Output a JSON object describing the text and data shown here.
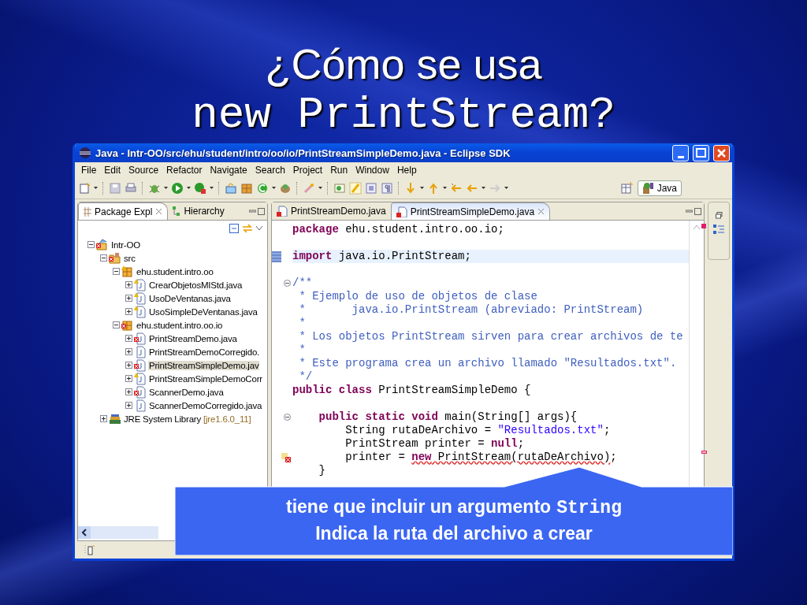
{
  "slide": {
    "title_lines": [
      "¿Cómo se usa",
      "new PrintStream?"
    ]
  },
  "window": {
    "title": "Java - Intr-OO/src/ehu/student/intro/oo/io/PrintStreamSimpleDemo.java - Eclipse SDK"
  },
  "menu": [
    "File",
    "Edit",
    "Source",
    "Refactor",
    "Navigate",
    "Search",
    "Project",
    "Run",
    "Window",
    "Help"
  ],
  "perspective": {
    "label": "Java",
    "selected": true
  },
  "left_tabs": [
    {
      "label": "Package Expl",
      "selected": true
    },
    {
      "label": "Hierarchy",
      "selected": false
    }
  ],
  "tree": [
    {
      "label": "Intr-OO",
      "kind": "project",
      "error": true,
      "warning": false,
      "expanded": true,
      "selected": false,
      "children": [
        {
          "label": "src",
          "kind": "folder",
          "error": true,
          "warning": false,
          "expanded": true,
          "selected": false,
          "children": [
            {
              "label": "ehu.student.intro.oo",
              "kind": "package",
              "error": false,
              "warning": true,
              "expanded": true,
              "selected": false,
              "children": [
                {
                  "label": "CrearObjetosMIStd.java",
                  "kind": "file",
                  "error": false,
                  "warning": true,
                  "expanded": false,
                  "selected": false
                },
                {
                  "label": "UsoDeVentanas.java",
                  "kind": "file",
                  "error": false,
                  "warning": true,
                  "expanded": false,
                  "selected": false
                },
                {
                  "label": "UsoSimpleDeVentanas.java",
                  "kind": "file",
                  "error": false,
                  "warning": true,
                  "expanded": false,
                  "selected": false
                }
              ]
            },
            {
              "label": "ehu.student.intro.oo.io",
              "kind": "package",
              "error": true,
              "warning": false,
              "expanded": true,
              "selected": false,
              "children": [
                {
                  "label": "PrintStreamDemo.java",
                  "kind": "file",
                  "error": true,
                  "warning": false,
                  "expanded": false,
                  "selected": false
                },
                {
                  "label": "PrintStreamDemoCorregido.",
                  "kind": "file",
                  "error": false,
                  "warning": false,
                  "expanded": false,
                  "selected": false
                },
                {
                  "label": "PrintStreamSimpleDemo.jav",
                  "kind": "file",
                  "error": true,
                  "warning": false,
                  "expanded": false,
                  "selected": true
                },
                {
                  "label": "PrintStreamSimpleDemoCorr",
                  "kind": "file",
                  "error": false,
                  "warning": true,
                  "expanded": false,
                  "selected": false
                },
                {
                  "label": "ScannerDemo.java",
                  "kind": "file",
                  "error": true,
                  "warning": false,
                  "expanded": false,
                  "selected": false
                },
                {
                  "label": "ScannerDemoCorregido.java",
                  "kind": "file",
                  "error": false,
                  "warning": false,
                  "expanded": false,
                  "selected": false
                }
              ]
            }
          ]
        },
        {
          "label": "JRE System Library",
          "decoration": "[jre1.6.0_11]",
          "kind": "library",
          "error": false,
          "warning": false,
          "expanded": false,
          "selected": false
        }
      ]
    }
  ],
  "editor_tabs": [
    {
      "label": "PrintStreamDemo.java",
      "selected": false,
      "error": true
    },
    {
      "label": "PrintStreamSimpleDemo.java",
      "selected": true,
      "error": true
    }
  ],
  "code": [
    {
      "kind": "plain",
      "current": false,
      "segments": [
        {
          "kind": "keyword",
          "text": "package"
        },
        {
          "kind": "plain",
          "text": " ehu.student.intro.oo.io;"
        }
      ]
    },
    {
      "kind": "plain",
      "current": false
    },
    {
      "kind": "bookmark",
      "current": true,
      "segments": [
        {
          "kind": "keyword",
          "text": "import"
        },
        {
          "kind": "plain",
          "text": " java.io.PrintStream;"
        }
      ]
    },
    {
      "kind": "plain",
      "current": false
    },
    {
      "kind": "fold",
      "current": false,
      "segments": [
        {
          "kind": "comment",
          "text": "/**"
        }
      ]
    },
    {
      "kind": "plain",
      "current": false,
      "segments": [
        {
          "kind": "comment",
          "text": " * Ejemplo de uso de objetos de clase"
        }
      ]
    },
    {
      "kind": "plain",
      "current": false,
      "segments": [
        {
          "kind": "comment",
          "text": " *       java.io.PrintStream (abreviado: PrintStream)"
        }
      ]
    },
    {
      "kind": "plain",
      "current": false,
      "segments": [
        {
          "kind": "comment",
          "text": " *"
        }
      ]
    },
    {
      "kind": "plain",
      "current": false,
      "segments": [
        {
          "kind": "comment",
          "text": " * Los objetos PrintStream sirven para crear archivos de te"
        }
      ]
    },
    {
      "kind": "plain",
      "current": false,
      "segments": [
        {
          "kind": "comment",
          "text": " *"
        }
      ]
    },
    {
      "kind": "plain",
      "current": false,
      "segments": [
        {
          "kind": "comment",
          "text": " * Este programa crea un archivo llamado \"Resultados.txt\"."
        }
      ]
    },
    {
      "kind": "plain",
      "current": false,
      "segments": [
        {
          "kind": "comment",
          "text": " */"
        }
      ]
    },
    {
      "kind": "plain",
      "current": false,
      "segments": [
        {
          "kind": "keyword",
          "text": "public class"
        },
        {
          "kind": "plain",
          "text": " PrintStreamSimpleDemo {"
        }
      ]
    },
    {
      "kind": "plain",
      "current": false
    },
    {
      "kind": "fold",
      "current": false,
      "segments": [
        {
          "kind": "keyword",
          "text": "    public static void"
        },
        {
          "kind": "plain",
          "text": " main(String[] args){"
        }
      ]
    },
    {
      "kind": "plain",
      "current": false,
      "segments": [
        {
          "kind": "plain",
          "text": "        String rutaDeArchivo = "
        },
        {
          "kind": "string",
          "text": "\"Resultados.txt\""
        },
        {
          "kind": "plain",
          "text": ";"
        }
      ]
    },
    {
      "kind": "plain",
      "current": false,
      "segments": [
        {
          "kind": "plain",
          "text": "        PrintStream printer = "
        },
        {
          "kind": "keyword",
          "text": "null"
        },
        {
          "kind": "plain",
          "text": ";"
        }
      ]
    },
    {
      "kind": "error",
      "current": false,
      "segments": [
        {
          "kind": "plain",
          "text": "        printer = "
        },
        {
          "kind": "error-keyword",
          "text": "new"
        },
        {
          "kind": "error",
          "text": " PrintStream(rutaDeArchivo)"
        },
        {
          "kind": "plain",
          "text": ";"
        }
      ]
    },
    {
      "kind": "plain",
      "current": false,
      "segments": [
        {
          "kind": "plain",
          "text": "    }"
        }
      ]
    }
  ],
  "callout": {
    "line_1": "tiene que incluir un argumento",
    "line_1_code": "String",
    "line_2": "Indica la ruta del archivo a crear"
  }
}
